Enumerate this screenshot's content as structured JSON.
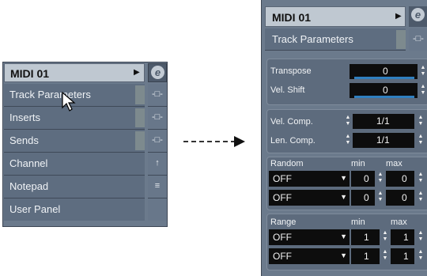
{
  "left": {
    "track_name": "MIDI 01",
    "expand_arrow": "▶",
    "edit_icon": "e",
    "sections": [
      {
        "label": "Track Parameters",
        "icon": "-□-"
      },
      {
        "label": "Inserts",
        "icon": "-□-"
      },
      {
        "label": "Sends",
        "icon": "-□-"
      },
      {
        "label": "Channel",
        "icon": "↑"
      },
      {
        "label": "Notepad",
        "icon": "≡"
      },
      {
        "label": "User Panel",
        "icon": ""
      }
    ]
  },
  "right": {
    "track_name": "MIDI 01",
    "expand_arrow": "▶",
    "edit_icon": "e",
    "section_label": "Track Parameters",
    "transpose_label": "Transpose",
    "transpose_value": "0",
    "vel_shift_label": "Vel. Shift",
    "vel_shift_value": "0",
    "vel_comp_label": "Vel. Comp.",
    "vel_comp_value": "1/1",
    "len_comp_label": "Len. Comp.",
    "len_comp_value": "1/1",
    "random": {
      "label": "Random",
      "min_label": "min",
      "max_label": "max",
      "rows": [
        {
          "mode": "OFF",
          "min": "0",
          "max": "0"
        },
        {
          "mode": "OFF",
          "min": "0",
          "max": "0"
        }
      ]
    },
    "range": {
      "label": "Range",
      "min_label": "min",
      "max_label": "max",
      "rows": [
        {
          "mode": "OFF",
          "min": "1",
          "max": "1"
        },
        {
          "mode": "OFF",
          "min": "1",
          "max": "1"
        }
      ]
    }
  }
}
